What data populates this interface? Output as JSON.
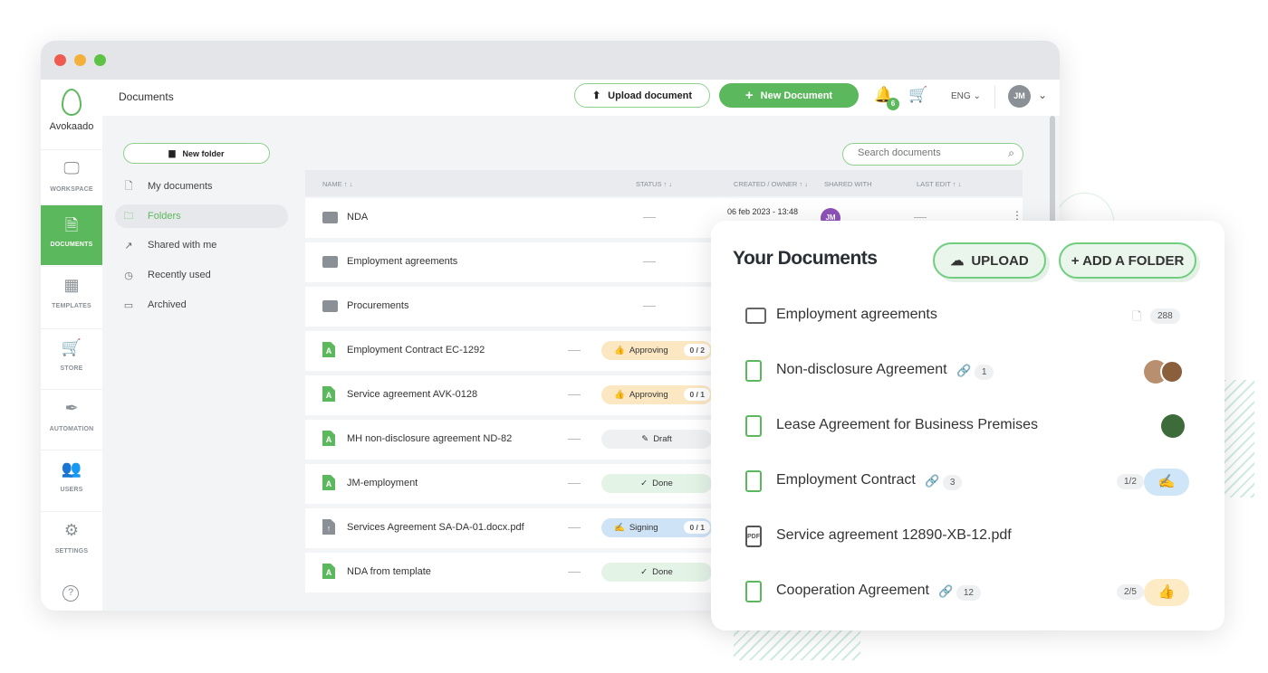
{
  "app": {
    "brand": "Avokaado",
    "page_title": "Documents"
  },
  "sidebar": {
    "items": [
      {
        "label": "WORKSPACE",
        "icon": "monitor-icon"
      },
      {
        "label": "DOCUMENTS",
        "icon": "document-icon",
        "active": true
      },
      {
        "label": "TEMPLATES",
        "icon": "grid-icon"
      },
      {
        "label": "STORE",
        "icon": "cart-icon"
      },
      {
        "label": "AUTOMATION",
        "icon": "pen-icon"
      },
      {
        "label": "USERS",
        "icon": "users-icon"
      },
      {
        "label": "SETTINGS",
        "icon": "gear-icon"
      }
    ],
    "help": "?"
  },
  "header": {
    "upload": "Upload document",
    "new_doc": "New Document",
    "notifications": "6",
    "lang": "ENG",
    "avatar": "JM"
  },
  "nav": {
    "new_folder": "New folder",
    "items": [
      "My documents",
      "Folders",
      "Shared with me",
      "Recently used",
      "Archived"
    ],
    "active": "Folders"
  },
  "search": {
    "placeholder": "Search documents"
  },
  "table": {
    "headers": [
      "NAME ↑ ↓",
      "STATUS ↑ ↓",
      "CREATED / OWNER ↑ ↓",
      "SHARED WITH",
      "LAST EDIT ↑ ↓"
    ],
    "rows": [
      {
        "name": "NDA",
        "type": "folder",
        "created": "06 feb 2023 - 13:48",
        "shared": "JM"
      },
      {
        "name": "Employment agreements",
        "type": "folder"
      },
      {
        "name": "Procurements",
        "type": "shared-folder"
      },
      {
        "name": "Employment Contract EC-1292",
        "type": "doc",
        "status": "Approving",
        "count": "0 / 2"
      },
      {
        "name": "Service agreement AVK-0128",
        "type": "doc",
        "status": "Approving",
        "count": "0 / 1"
      },
      {
        "name": "MH non-disclosure agreement ND-82",
        "type": "doc",
        "status": "Draft"
      },
      {
        "name": "JM-employment",
        "type": "doc",
        "status": "Done"
      },
      {
        "name": "Services Agreement SA-DA-01.docx.pdf",
        "type": "upload",
        "status": "Signing",
        "count": "0 / 1"
      },
      {
        "name": "NDA from template",
        "type": "doc",
        "status": "Done"
      }
    ]
  },
  "status_colors": {
    "Approving": "#fbe7c2",
    "Draft": "#eef0f2",
    "Done": "#e3f3e6",
    "Signing": "#cfe3f7"
  },
  "card": {
    "title": "Your Documents",
    "upload": "UPLOAD",
    "add_folder": "+ ADD A FOLDER",
    "items": [
      {
        "name": "Employment agreements",
        "icon": "folder-icon",
        "count": "288"
      },
      {
        "name": "Non-disclosure Agreement",
        "icon": "doc-icon",
        "links": "1"
      },
      {
        "name": "Lease Agreement for Business Premises",
        "icon": "doc-icon"
      },
      {
        "name": "Employment Contract",
        "icon": "doc-icon",
        "links": "3",
        "progress": "1/2",
        "state": "signing"
      },
      {
        "name": "Service agreement 12890-XB-12.pdf",
        "icon": "pdf-icon"
      },
      {
        "name": "Cooperation Agreement",
        "icon": "doc-icon",
        "links": "12",
        "progress": "2/5",
        "state": "approving"
      }
    ]
  },
  "colors": {
    "brand": "#5cb85c"
  }
}
